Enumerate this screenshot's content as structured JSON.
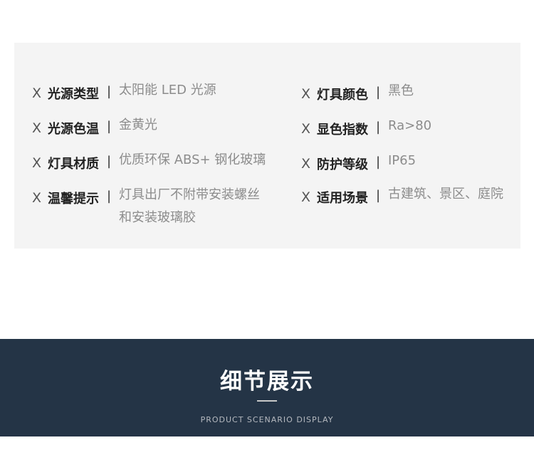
{
  "specs": {
    "mark": "X",
    "separator": "|",
    "left": [
      {
        "label": "光源类型",
        "value": "太阳能 LED 光源"
      },
      {
        "label": "光源色温",
        "value": "金黄光"
      },
      {
        "label": "灯具材质",
        "value": "优质环保 ABS+ 钢化玻璃"
      },
      {
        "label": "温馨提示",
        "value": "灯具出厂不附带安装螺丝和安装玻璃胶"
      }
    ],
    "right": [
      {
        "label": "灯具颜色",
        "value": "黑色"
      },
      {
        "label": "显色指数",
        "value": "Ra>80"
      },
      {
        "label": "防护等级",
        "value": "IP65"
      },
      {
        "label": "适用场景",
        "value": "古建筑、景区、庭院"
      }
    ]
  },
  "banner": {
    "title": "细节展示",
    "subtitle": "PRODUCT SCENARIO DISPLAY"
  },
  "colors": {
    "panel_bg": "#f4f4f4",
    "banner_bg": "#243446"
  }
}
